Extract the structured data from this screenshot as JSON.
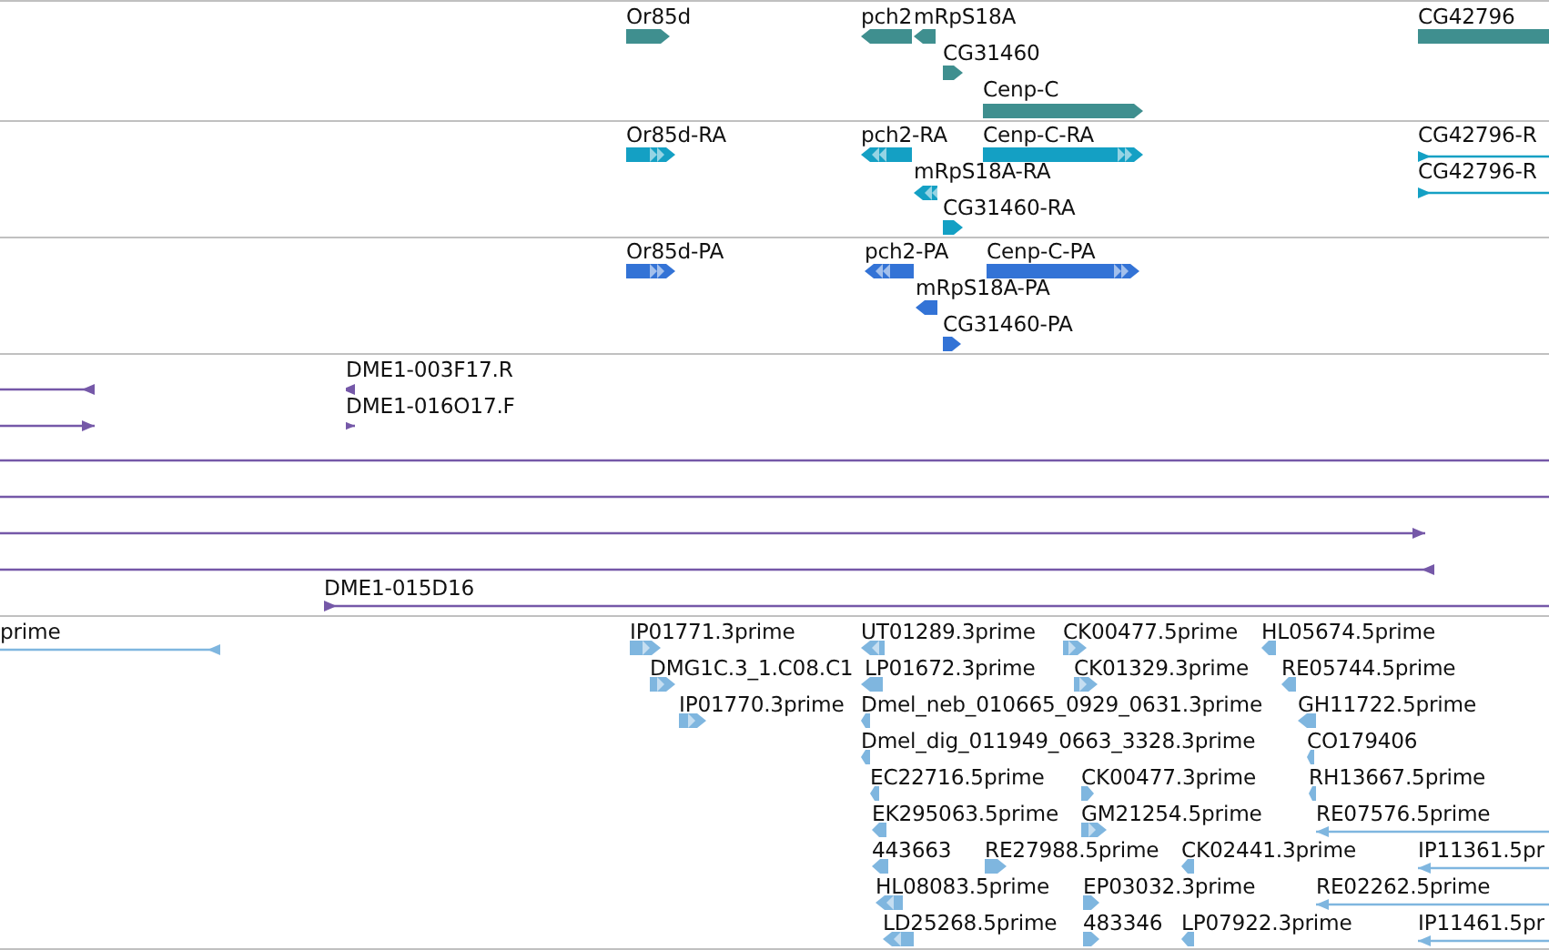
{
  "tracks": [
    {
      "kind": "gene",
      "features": [
        {
          "label": "Or85d",
          "reverse": false
        },
        {
          "label": "pch2",
          "reverse": true
        },
        {
          "label": "mRpS18A",
          "reverse": true
        },
        {
          "label": "CG31460",
          "reverse": false
        },
        {
          "label": "Cenp-C",
          "reverse": false
        },
        {
          "label": "CG42796"
        }
      ]
    },
    {
      "kind": "mrna",
      "features": [
        {
          "label": "Or85d-RA",
          "reverse": false
        },
        {
          "label": "pch2-RA",
          "reverse": true
        },
        {
          "label": "Cenp-C-RA",
          "reverse": false
        },
        {
          "label": "CG42796-R",
          "reverse": false
        },
        {
          "label": "mRpS18A-RA",
          "reverse": true
        },
        {
          "label": "CG42796-R",
          "reverse": false
        },
        {
          "label": "CG31460-RA",
          "reverse": false
        }
      ]
    },
    {
      "kind": "protein",
      "features": [
        {
          "label": "Or85d-PA",
          "reverse": false
        },
        {
          "label": "pch2-PA",
          "reverse": true
        },
        {
          "label": "Cenp-C-PA",
          "reverse": false
        },
        {
          "label": "mRpS18A-PA",
          "reverse": true
        },
        {
          "label": "CG31460-PA",
          "reverse": false
        }
      ]
    },
    {
      "kind": "bac",
      "features": [
        {
          "reverse": true
        },
        {
          "label": "DME1-003F17.R",
          "reverse": true
        },
        {
          "reverse": false
        },
        {
          "label": "DME1-016O17.F",
          "reverse": false
        },
        {
          "arrow": false
        },
        {
          "arrow": false
        },
        {
          "reverse": false
        },
        {
          "reverse": true
        },
        {
          "label": "DME1-015D16",
          "reverse": false
        }
      ]
    },
    {
      "kind": "est",
      "features": [
        {
          "label": "prime",
          "reverse": true
        },
        {
          "label": "IP01771.3prime",
          "reverse": false
        },
        {
          "label": "UT01289.3prime",
          "reverse": true
        },
        {
          "label": "CK00477.5prime",
          "reverse": false
        },
        {
          "label": "HL05674.5prime",
          "reverse": true
        },
        {
          "label": "DMG1C.3_1.C08.C1",
          "reverse": false
        },
        {
          "label": "LP01672.3prime",
          "reverse": true
        },
        {
          "label": "CK01329.3prime",
          "reverse": false
        },
        {
          "label": "RE05744.5prime",
          "reverse": true
        },
        {
          "label": "IP01770.3prime",
          "reverse": false
        },
        {
          "label": "Dmel_neb_010665_0929_0631.3prime",
          "reverse": true
        },
        {
          "label": "GH11722.5prime",
          "reverse": true
        },
        {
          "label": "Dmel_dig_011949_0663_3328.3prime",
          "reverse": true
        },
        {
          "label": "CO179406",
          "reverse": true
        },
        {
          "label": "EC22716.5prime",
          "reverse": true
        },
        {
          "label": "CK00477.3prime",
          "reverse": false
        },
        {
          "label": "RH13667.5prime",
          "reverse": true
        },
        {
          "label": "EK295063.5prime",
          "reverse": true
        },
        {
          "label": "GM21254.5prime",
          "reverse": false
        },
        {
          "label": "RE07576.5prime",
          "reverse": true
        },
        {
          "label": "443663",
          "reverse": true
        },
        {
          "label": "RE27988.5prime",
          "reverse": false
        },
        {
          "label": "CK02441.3prime",
          "reverse": true
        },
        {
          "label": "IP11361.5pr",
          "reverse": true
        },
        {
          "label": "HL08083.5prime",
          "reverse": true
        },
        {
          "label": "EP03032.3prime",
          "reverse": false
        },
        {
          "label": "RE02262.5prime",
          "reverse": true
        },
        {
          "label": "LD25268.5prime",
          "reverse": true
        },
        {
          "label": "483346",
          "reverse": false
        },
        {
          "label": "LP07922.3prime",
          "reverse": true
        },
        {
          "label": "IP11461.5pr",
          "reverse": true
        }
      ]
    }
  ]
}
